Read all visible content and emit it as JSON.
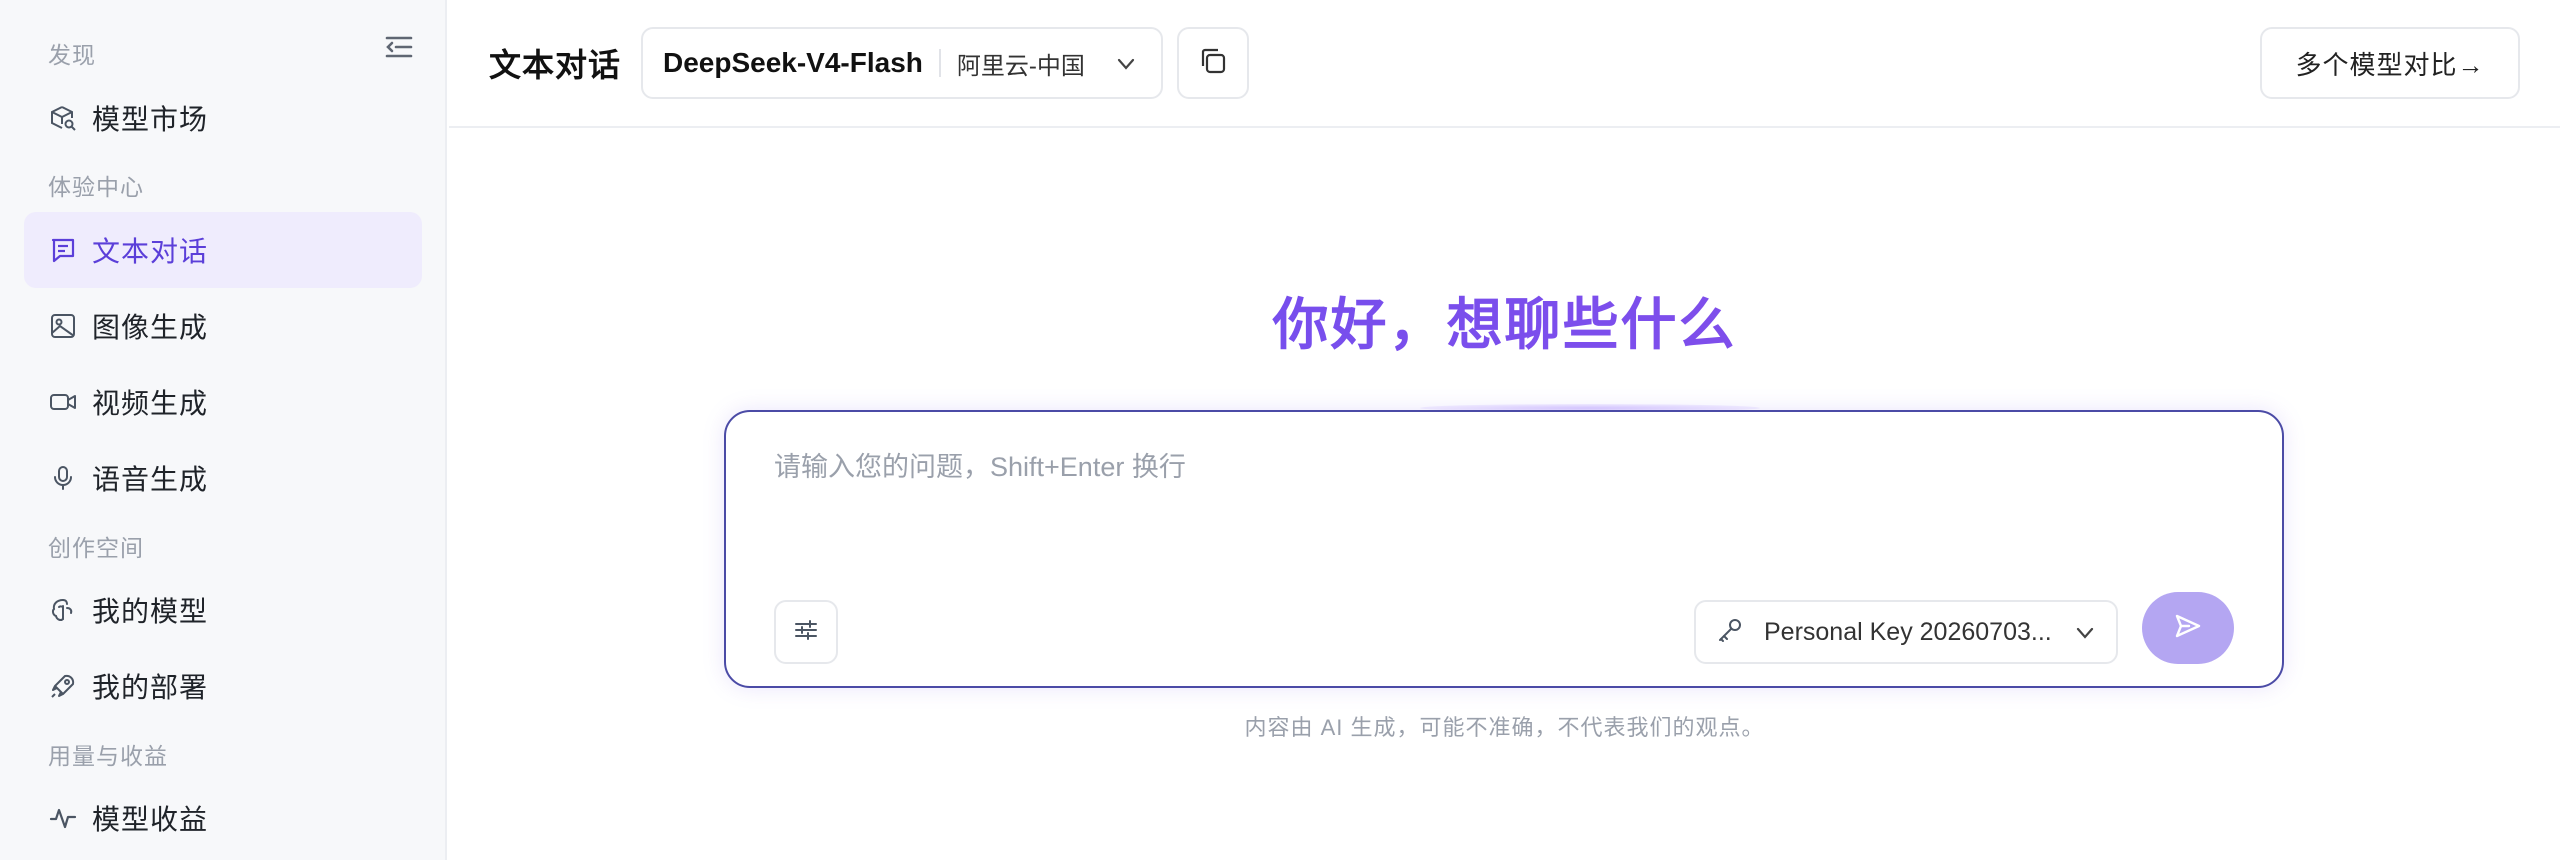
{
  "sidebar": {
    "sections": [
      {
        "label": "发现"
      },
      {
        "label": "体验中心"
      },
      {
        "label": "创作空间"
      },
      {
        "label": "用量与收益"
      }
    ],
    "items": [
      {
        "label": "模型市场",
        "icon": "cube-search-icon"
      },
      {
        "label": "文本对话",
        "icon": "chat-text-icon",
        "active": true
      },
      {
        "label": "图像生成",
        "icon": "image-icon"
      },
      {
        "label": "视频生成",
        "icon": "video-icon"
      },
      {
        "label": "语音生成",
        "icon": "microphone-icon"
      },
      {
        "label": "我的模型",
        "icon": "brain-icon"
      },
      {
        "label": "我的部署",
        "icon": "rocket-icon"
      },
      {
        "label": "模型收益",
        "icon": "activity-icon"
      }
    ]
  },
  "header": {
    "title": "文本对话",
    "model_name": "DeepSeek-V4-Flash",
    "model_region": "阿里云-中国",
    "compare_label": "多个模型对比→"
  },
  "main": {
    "greeting": "你好，想聊些什么",
    "input_placeholder": "请输入您的问题，Shift+Enter 换行",
    "key_label": "Personal Key 20260703...",
    "disclaimer": "内容由 AI 生成，可能不准确，不代表我们的观点。"
  },
  "colors": {
    "accent": "#5b3fd9",
    "active_bg": "#efecfd",
    "send_button": "#b4a6f2",
    "composer_border": "#4b4ba6"
  }
}
